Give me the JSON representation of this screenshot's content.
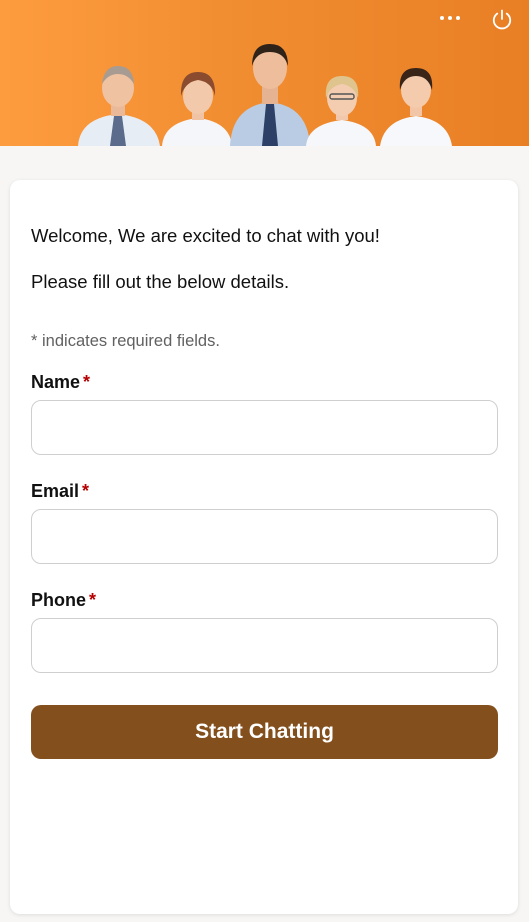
{
  "header": {
    "more_icon": "more-horizontal-icon",
    "power_icon": "power-icon",
    "banner_image": "team-of-people-photo",
    "accent_color": "#f18d31"
  },
  "form": {
    "welcome": "Welcome, We are excited to chat with you!",
    "instruction": "Please fill out the below details.",
    "required_note": "* indicates required fields.",
    "required_marker": "*",
    "fields": {
      "name": {
        "label": "Name",
        "value": "",
        "placeholder": ""
      },
      "email": {
        "label": "Email",
        "value": "",
        "placeholder": ""
      },
      "phone": {
        "label": "Phone",
        "value": "",
        "placeholder": ""
      }
    },
    "submit_label": "Start Chatting",
    "button_color": "#824f1d",
    "required_color": "#b40000"
  }
}
